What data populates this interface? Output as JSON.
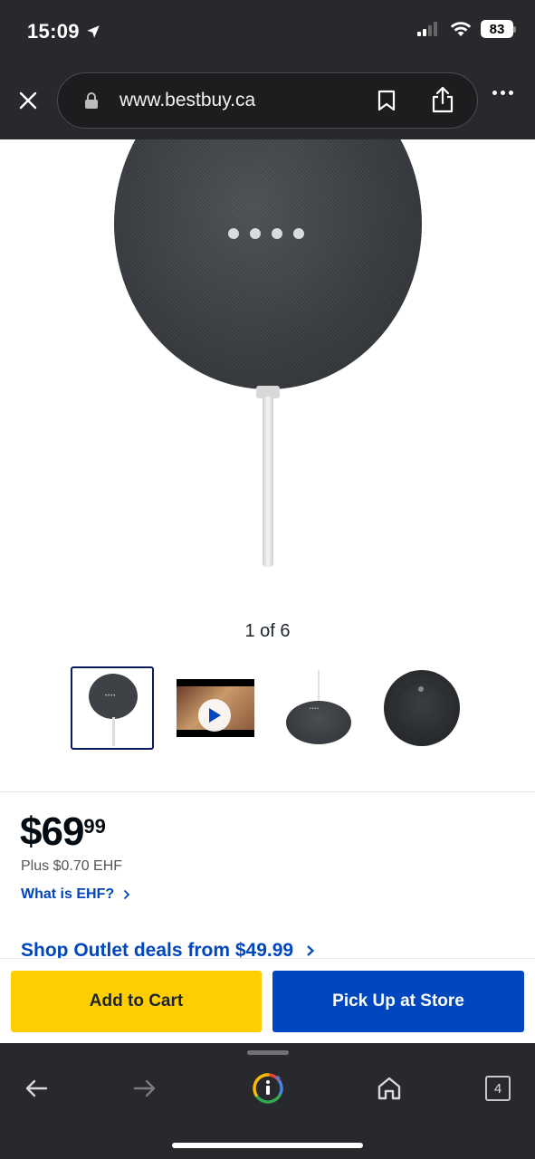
{
  "status_bar": {
    "time": "15:09",
    "battery": "83"
  },
  "browser": {
    "url": "www.bestbuy.ca",
    "tab_count": "4"
  },
  "gallery": {
    "counter": "1 of 6"
  },
  "product": {
    "price_dollars": "$69",
    "price_cents": "99",
    "ehf_text": "Plus $0.70 EHF",
    "ehf_link": "What is EHF?",
    "outlet_link": "Shop Outlet deals from $49.99"
  },
  "actions": {
    "add_to_cart": "Add to Cart",
    "pick_up": "Pick Up at Store"
  },
  "colors": {
    "accent_blue": "#0046be",
    "cart_yellow": "#ffce00",
    "chrome_dark": "#27292c"
  }
}
